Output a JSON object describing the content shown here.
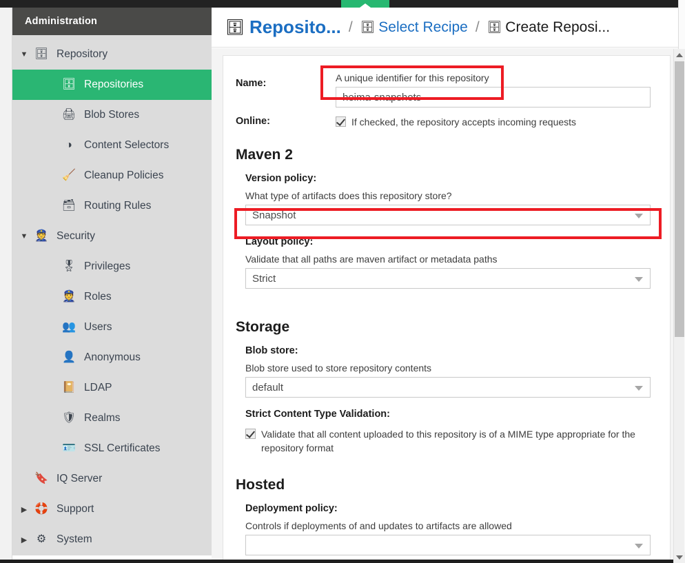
{
  "window": {
    "accent_green": "#2ab673",
    "annotation_color": "#ed1c24",
    "link_color": "#1b6ec2",
    "header_bg": "#4a4a48",
    "sidebar_bg": "#dcdcdc"
  },
  "sidebar": {
    "title": "Administration",
    "items": [
      {
        "label": "Repository",
        "icon": "database-icon",
        "glyph": "🗄",
        "level": 0,
        "caret": "down",
        "selected": false
      },
      {
        "label": "Repositories",
        "icon": "database-icon",
        "glyph": "🗄",
        "level": 1,
        "caret": "none",
        "selected": true
      },
      {
        "label": "Blob Stores",
        "icon": "blob-store-icon",
        "glyph": "🖨",
        "level": 1,
        "caret": "none",
        "selected": false
      },
      {
        "label": "Content Selectors",
        "icon": "content-selector-icon",
        "glyph": "◑",
        "level": 1,
        "caret": "none",
        "selected": false
      },
      {
        "label": "Cleanup Policies",
        "icon": "broom-icon",
        "glyph": "🧹",
        "level": 1,
        "caret": "none",
        "selected": false
      },
      {
        "label": "Routing Rules",
        "icon": "routing-rules-icon",
        "glyph": "🗃",
        "level": 1,
        "caret": "none",
        "selected": false
      },
      {
        "label": "Security",
        "icon": "security-badge-icon",
        "glyph": "👮",
        "level": 0,
        "caret": "down",
        "selected": false
      },
      {
        "label": "Privileges",
        "icon": "medal-icon",
        "glyph": "🎖",
        "level": 1,
        "caret": "none",
        "selected": false
      },
      {
        "label": "Roles",
        "icon": "roles-person-icon",
        "glyph": "👮",
        "level": 1,
        "caret": "none",
        "selected": false
      },
      {
        "label": "Users",
        "icon": "users-icon",
        "glyph": "👥",
        "level": 1,
        "caret": "none",
        "selected": false
      },
      {
        "label": "Anonymous",
        "icon": "anonymous-user-icon",
        "glyph": "👤",
        "level": 1,
        "caret": "none",
        "selected": false
      },
      {
        "label": "LDAP",
        "icon": "address-book-icon",
        "glyph": "📔",
        "level": 1,
        "caret": "none",
        "selected": false
      },
      {
        "label": "Realms",
        "icon": "shield-icon",
        "glyph": "🛡",
        "level": 1,
        "caret": "none",
        "selected": false
      },
      {
        "label": "SSL Certificates",
        "icon": "certificate-icon",
        "glyph": "🪪",
        "level": 1,
        "caret": "none",
        "selected": false
      },
      {
        "label": "IQ Server",
        "icon": "iq-server-icon",
        "glyph": "🔖",
        "level": 0,
        "caret": "none",
        "selected": false
      },
      {
        "label": "Support",
        "icon": "lifebuoy-icon",
        "glyph": "🛟",
        "level": 0,
        "caret": "right",
        "selected": false
      },
      {
        "label": "System",
        "icon": "gear-icon",
        "glyph": "⚙",
        "level": 0,
        "caret": "right",
        "selected": false
      }
    ]
  },
  "breadcrumb": {
    "root": {
      "label": "Reposito...",
      "icon": "database-icon",
      "glyph": "🗄"
    },
    "separator": "/",
    "trail": [
      {
        "label": "Select Recipe",
        "icon": "database-icon",
        "glyph": "🗄",
        "current": false
      },
      {
        "label": "Create Reposi...",
        "icon": "database-icon",
        "glyph": "🗄",
        "current": true
      }
    ]
  },
  "form": {
    "name": {
      "label": "Name:",
      "helper": "A unique identifier for this repository",
      "value": "heima-snapshots",
      "placeholder": ""
    },
    "online": {
      "label": "Online:",
      "checkbox_text": "If checked, the repository accepts incoming requests",
      "checked": true
    },
    "maven": {
      "section_title": "Maven 2",
      "version_policy": {
        "label": "Version policy:",
        "helper": "What type of artifacts does this repository store?",
        "value": "Snapshot"
      },
      "layout_policy": {
        "label": "Layout policy:",
        "helper": "Validate that all paths are maven artifact or metadata paths",
        "value": "Strict"
      }
    },
    "storage": {
      "section_title": "Storage",
      "blob_store": {
        "label": "Blob store:",
        "helper": "Blob store used to store repository contents",
        "value": "default"
      },
      "strict_content": {
        "label": "Strict Content Type Validation:",
        "checkbox_text": "Validate that all content uploaded to this repository is of a MIME type appropriate for the repository format",
        "checked": true
      }
    },
    "hosted": {
      "section_title": "Hosted",
      "deployment_policy": {
        "label": "Deployment policy:",
        "helper": "Controls if deployments of and updates to artifacts are allowed",
        "value": ""
      }
    }
  }
}
